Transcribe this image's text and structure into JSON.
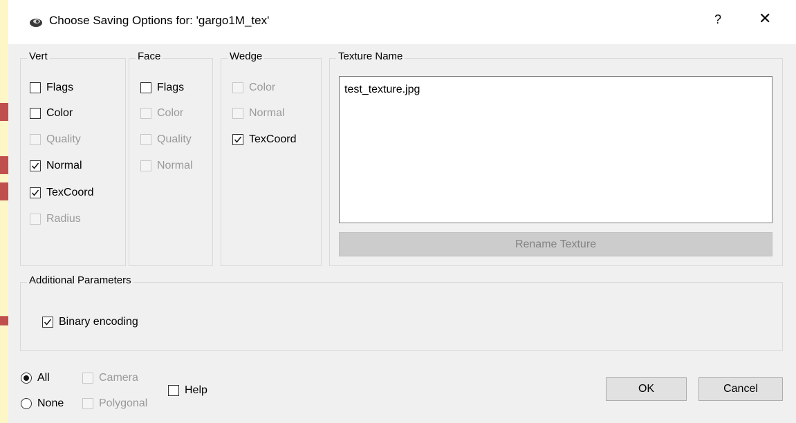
{
  "window": {
    "title": "Choose Saving Options for: 'gargo1M_tex'",
    "help_glyph": "?",
    "close_glyph": "✕"
  },
  "vert": {
    "title": "Vert",
    "items": [
      {
        "label": "Flags",
        "checked": false,
        "enabled": true
      },
      {
        "label": "Color",
        "checked": false,
        "enabled": true
      },
      {
        "label": "Quality",
        "checked": false,
        "enabled": false
      },
      {
        "label": "Normal",
        "checked": true,
        "enabled": true
      },
      {
        "label": "TexCoord",
        "checked": true,
        "enabled": true
      },
      {
        "label": "Radius",
        "checked": false,
        "enabled": false
      }
    ]
  },
  "face": {
    "title": "Face",
    "items": [
      {
        "label": "Flags",
        "checked": false,
        "enabled": true
      },
      {
        "label": "Color",
        "checked": false,
        "enabled": false
      },
      {
        "label": "Quality",
        "checked": false,
        "enabled": false
      },
      {
        "label": "Normal",
        "checked": false,
        "enabled": false
      }
    ]
  },
  "wedge": {
    "title": "Wedge",
    "items": [
      {
        "label": "Color",
        "checked": false,
        "enabled": false
      },
      {
        "label": "Normal",
        "checked": false,
        "enabled": false
      },
      {
        "label": "TexCoord",
        "checked": true,
        "enabled": true
      }
    ]
  },
  "texture": {
    "title": "Texture Name",
    "value": "test_texture.jpg",
    "rename_label": "Rename Texture"
  },
  "additional": {
    "title": "Additional Parameters",
    "binary_label": "Binary encoding",
    "binary_checked": true
  },
  "bottom": {
    "all_label": "All",
    "none_label": "None",
    "camera_label": "Camera",
    "polygonal_label": "Polygonal",
    "help_label": "Help",
    "ok_label": "OK",
    "cancel_label": "Cancel"
  },
  "colors": {
    "accent_arrow": "#c0504d",
    "background": "#fdf7c8",
    "dialog": "#f0f0f0"
  }
}
